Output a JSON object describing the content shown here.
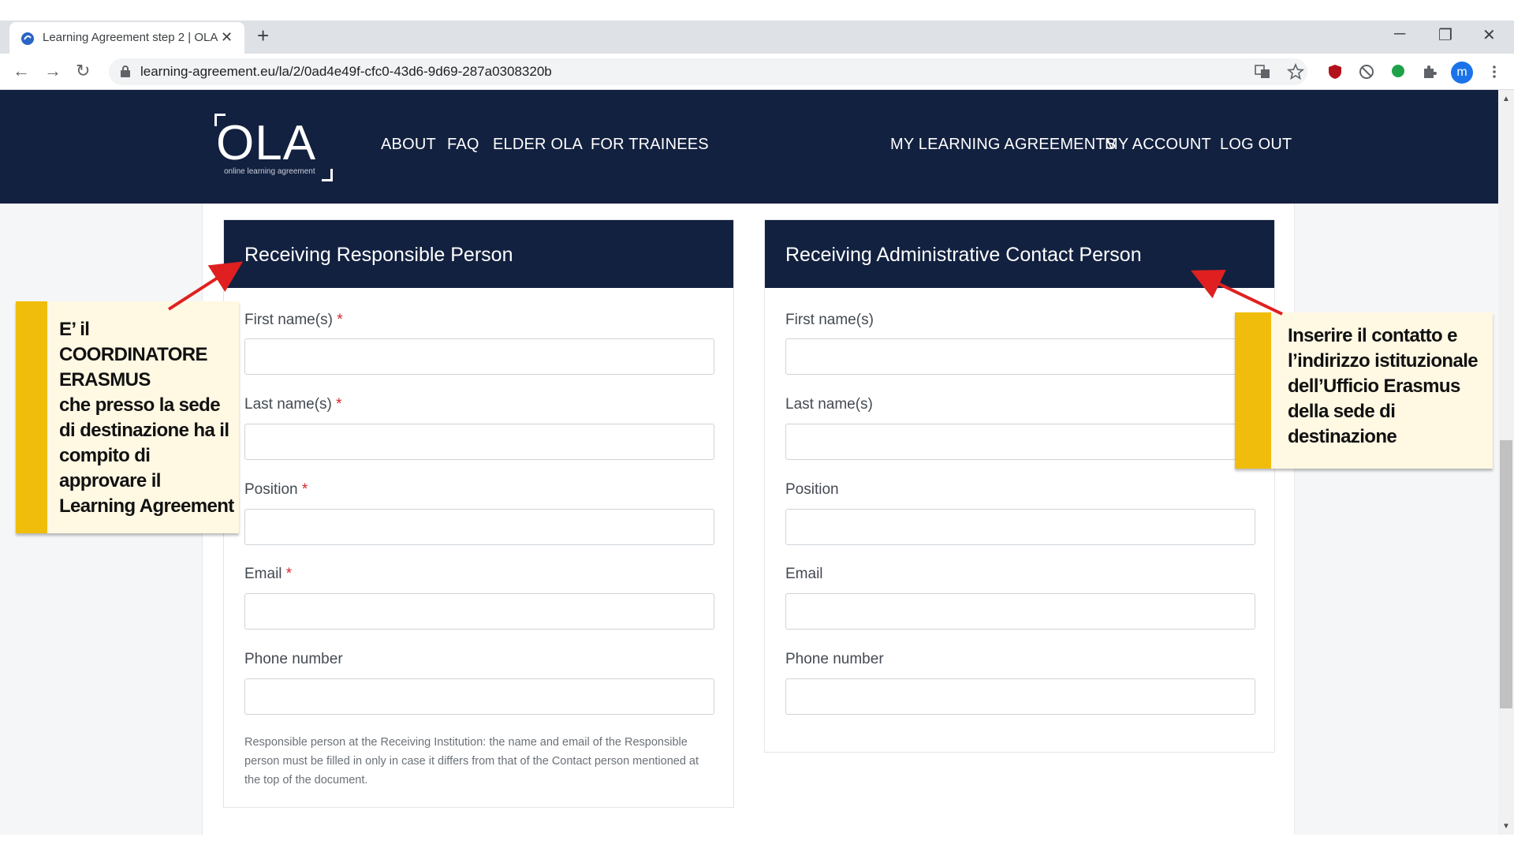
{
  "browser": {
    "tab_title": "Learning Agreement step 2 | OLA",
    "tab_close": "✕",
    "new_tab": "+",
    "url": "learning-agreement.eu/la/2/0ad4e49f-cfc0-43d6-9d69-287a0308320b",
    "profile_initial": "m",
    "window_controls": {
      "minimize": "─",
      "restore": "❐",
      "close": "✕"
    },
    "nav": {
      "back": "←",
      "forward": "→",
      "reload": "↻"
    },
    "icons": [
      "translate-icon",
      "star-icon",
      "shield-extension-icon",
      "blocker-extension-icon",
      "green-dot-extension-icon",
      "puzzle-icon",
      "profile-avatar",
      "kebab-menu-icon"
    ]
  },
  "site": {
    "logo": {
      "word": "OLA",
      "tagline": "online learning agreement"
    },
    "nav_left": [
      "ABOUT",
      "FAQ",
      "ELDER OLA",
      "FOR TRAINEES"
    ],
    "nav_right": [
      "MY LEARNING AGREEMENTS",
      "MY ACCOUNT",
      "LOG OUT"
    ]
  },
  "panels": {
    "responsible": {
      "title": "Receiving Responsible Person",
      "required_mark": "*",
      "fields": [
        "First name(s)",
        "Last name(s)",
        "Position",
        "Email",
        "Phone number"
      ],
      "note": "Responsible person at the Receiving Institution: the name and email of the Responsible person must be filled in only in case it differs from that of the Contact person mentioned at the top of the document."
    },
    "administrative": {
      "title": "Receiving Administrative Contact Person",
      "fields": [
        "First name(s)",
        "Last name(s)",
        "Position",
        "Email",
        "Phone number"
      ]
    }
  },
  "callouts": {
    "left": "E’ il COORDINATORE ERASMUS\nche presso la sede di destinazione ha il compito di approvare il Learning Agreement",
    "right": "Inserire il contatto e l’indirizzo istituzionale dell’Ufficio Erasmus della sede di destinazione"
  },
  "colors": {
    "navy": "#132140",
    "callout_bar": "#f0bd0c",
    "callout_bg": "#fff8e3",
    "arrow": "#e02020",
    "required": "#d6262e"
  }
}
